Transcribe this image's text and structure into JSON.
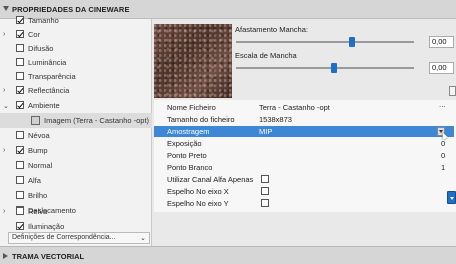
{
  "header": {
    "title": "PROPRIEDADES DA CINEWARE"
  },
  "channels": [
    {
      "label": "Tamanho",
      "checked": true,
      "expandable": false
    },
    {
      "label": "Cor",
      "checked": true,
      "expandable": true
    },
    {
      "label": "Difusão",
      "checked": false,
      "expandable": false
    },
    {
      "label": "Luminância",
      "checked": false,
      "expandable": false
    },
    {
      "label": "Transparência",
      "checked": false,
      "expandable": false
    },
    {
      "label": "Reflectância",
      "checked": true,
      "expandable": true
    },
    {
      "label": "Ambiente",
      "checked": true,
      "expandable": true,
      "expanded": true
    },
    {
      "label": "Imagem (Terra - Castanho -opt)",
      "selected": true
    },
    {
      "label": "Névoa",
      "checked": false,
      "expandable": false
    },
    {
      "label": "Bump",
      "checked": true,
      "expandable": true
    },
    {
      "label": "Normal",
      "checked": false,
      "expandable": false
    },
    {
      "label": "Alfa",
      "checked": false,
      "expandable": false
    },
    {
      "label": "Brilho",
      "checked": false,
      "expandable": false
    },
    {
      "label": "Deslocamento",
      "checked": false,
      "expandable": false
    },
    {
      "label": "Relva",
      "checked": false,
      "expandable": true
    },
    {
      "label": "Iluminação",
      "checked": true,
      "expandable": false
    }
  ],
  "mapping": {
    "label": "Definições de Correspondência..."
  },
  "sliders": {
    "spot_distance": {
      "label": "Afastamento Mancha:",
      "value": "0,00",
      "fraction": 0.65
    },
    "spot_scale": {
      "label": "Escala de Mancha",
      "value": "0,00",
      "fraction": 0.55
    }
  },
  "properties": [
    {
      "key": "Nome Ficheiro",
      "value": "Terra - Castanho -opt",
      "trail": "..."
    },
    {
      "key": "Tamanho do ficheiro",
      "value": "1538x873",
      "trail": ""
    },
    {
      "key": "Amostragem",
      "value": "MIP",
      "trail": "",
      "highlighted": true,
      "dropdown": true
    },
    {
      "key": "Exposição",
      "value": "",
      "trail": "0"
    },
    {
      "key": "Ponto Preto",
      "value": "",
      "trail": "0"
    },
    {
      "key": "Ponto Branco",
      "value": "",
      "trail": "1"
    },
    {
      "key": "Utilizar Canal Alfa Apenas",
      "value": "",
      "trail": "",
      "checkbox": true
    },
    {
      "key": "Espelho No eixo X",
      "value": "",
      "trail": "",
      "checkbox": true
    },
    {
      "key": "Espelho No eixo Y",
      "value": "",
      "trail": "",
      "checkbox": true
    }
  ],
  "footer": {
    "title": "TRAMA VECTORIAL"
  },
  "colors": {
    "accent": "#1f6fc8",
    "highlight": "#3e87d6",
    "header_bg": "#d6d6d6"
  },
  "icons": [
    "triangle-down-icon",
    "checkmark-icon",
    "chevron-down-icon",
    "mouse-cursor-icon"
  ]
}
